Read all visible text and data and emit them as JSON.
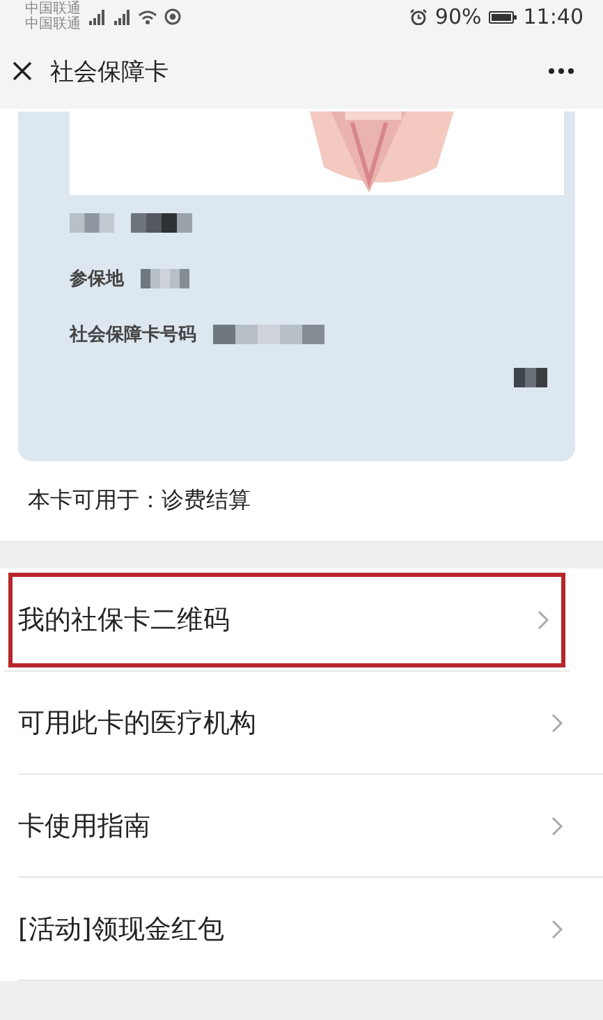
{
  "status_bar": {
    "carriers": [
      "中国联通",
      "中国联通"
    ],
    "battery": "90%",
    "time": "11:40"
  },
  "title_bar": {
    "title": "社会保障卡"
  },
  "card": {
    "fields": [
      {
        "label": "参保地"
      },
      {
        "label": "社会保障卡号码"
      }
    ]
  },
  "usage": "本卡可用于：诊费结算",
  "menu": [
    {
      "label": "我的社保卡二维码",
      "highlighted": true
    },
    {
      "label": "可用此卡的医疗机构",
      "highlighted": false
    },
    {
      "label": "卡使用指南",
      "highlighted": false
    },
    {
      "label": "[活动]领现金红包",
      "highlighted": false
    }
  ]
}
